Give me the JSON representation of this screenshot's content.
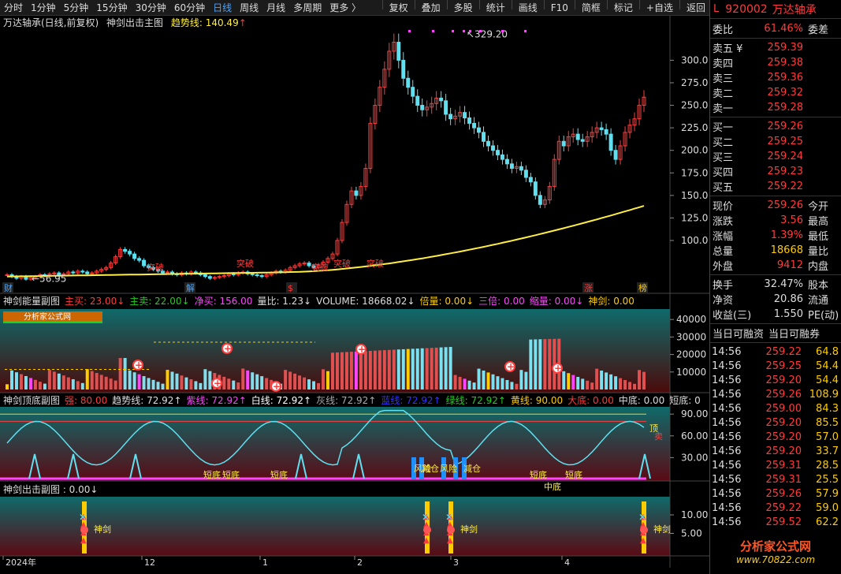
{
  "topbar": {
    "left": [
      "分时",
      "1分钟",
      "5分钟",
      "15分钟",
      "30分钟",
      "60分钟",
      "日线",
      "周线",
      "月线",
      "多周期",
      "更多 〉"
    ],
    "active": "日线",
    "right": [
      "复权",
      "叠加",
      "多股",
      "统计",
      "画线",
      "F10",
      "简框",
      "标记",
      "+自选",
      "返回"
    ]
  },
  "main_title": {
    "stock": "万达轴承(日线,前复权)",
    "indicator": "神剑出击主图",
    "trend_label": "趋势线: 140.49",
    "trend_arrow": "↑"
  },
  "main_axis": {
    "ticks": [
      100,
      125,
      150,
      175,
      200,
      225,
      250,
      275,
      300
    ],
    "max_label": "329.20",
    "min_label": "56.95"
  },
  "main_markers": {
    "left": "财",
    "jie": "解",
    "dollar": "$",
    "zhang": "涨",
    "bang": "榜"
  },
  "tupo_label": "突破",
  "vol_title": [
    {
      "t": "神剑能量副图",
      "c": "#ddd"
    },
    {
      "t": "主买: 23.00↓",
      "c": "#ff3b3b"
    },
    {
      "t": "主卖: 22.00↓",
      "c": "#22cc22"
    },
    {
      "t": "净买: 156.00",
      "c": "#ff44ff"
    },
    {
      "t": "量比: 1.23↓",
      "c": "#ddd"
    },
    {
      "t": "VOLUME: 18668.02↓",
      "c": "#ddd"
    },
    {
      "t": "倍量: 0.00↓",
      "c": "#ffcc00"
    },
    {
      "t": "三倍: 0.00",
      "c": "#ff44ff"
    },
    {
      "t": "缩量: 0.00↓",
      "c": "#ff44ff"
    },
    {
      "t": "神剑: 0.00",
      "c": "#ffcc00"
    }
  ],
  "vol_axis": {
    "ticks": [
      10000,
      20000,
      30000,
      40000
    ]
  },
  "osc_title": [
    {
      "t": "神剑顶底副图",
      "c": "#ddd"
    },
    {
      "t": "强: 80.00",
      "c": "#ff3b3b"
    },
    {
      "t": "趋势线: 72.92↑",
      "c": "#ddd"
    },
    {
      "t": "紫线: 72.92↑",
      "c": "#ff44ff"
    },
    {
      "t": "白线: 72.92↑",
      "c": "#fff"
    },
    {
      "t": "灰线: 72.92↑",
      "c": "#aaa"
    },
    {
      "t": "蓝线: 72.92↑",
      "c": "#3333ff"
    },
    {
      "t": "绿线: 72.92↑",
      "c": "#22cc22"
    },
    {
      "t": "黄线: 90.00",
      "c": "#ffcc00"
    },
    {
      "t": "大底: 0.00",
      "c": "#ff3b3b"
    },
    {
      "t": "中底: 0.00",
      "c": "#ddd"
    },
    {
      "t": "短底: 0",
      "c": "#ddd"
    }
  ],
  "osc_axis": {
    "ticks": [
      30,
      60,
      90
    ]
  },
  "osc_labels": {
    "top": "顶",
    "sell": "卖",
    "fengxian": "风险",
    "jiancang": "减仓",
    "duan": "短底",
    "zhong": "中底"
  },
  "sig_title": "神剑出击副图 : 0.00↓",
  "sig_axis": {
    "ticks": [
      5,
      10
    ]
  },
  "sig_label": "神剑",
  "xaxis": [
    "2024年",
    "12",
    "1",
    "2",
    "3",
    "4"
  ],
  "watermark_top": "分析家公式网",
  "right": {
    "code": "920002",
    "name": "万达轴承",
    "weibi": {
      "l": "委比",
      "v": "61.46%",
      "r": "委差"
    },
    "sells": [
      [
        "卖五 ¥",
        "259.39"
      ],
      [
        "卖四",
        "259.38"
      ],
      [
        "卖三",
        "259.36"
      ],
      [
        "卖二",
        "259.32"
      ],
      [
        "卖一",
        "259.28"
      ]
    ],
    "buys": [
      [
        "买一",
        "259.26"
      ],
      [
        "买二",
        "259.25"
      ],
      [
        "买三",
        "259.24"
      ],
      [
        "买四",
        "259.23"
      ],
      [
        "买五",
        "259.22"
      ]
    ],
    "quote": [
      {
        "l": "现价",
        "v": "259.26",
        "r": "今开",
        "c": "#ff3b3b"
      },
      {
        "l": "涨跌",
        "v": "3.56",
        "r": "最高",
        "c": "#ff3b3b"
      },
      {
        "l": "涨幅",
        "v": "1.39%",
        "r": "最低",
        "c": "#ff3b3b"
      },
      {
        "l": "总量",
        "v": "18668",
        "r": "量比",
        "c": "#ffcc00"
      },
      {
        "l": "外盘",
        "v": "9412",
        "r": "内盘",
        "c": "#ff3b3b"
      }
    ],
    "fund": [
      {
        "l": "换手",
        "v": "32.47%",
        "r": "股本"
      },
      {
        "l": "净资",
        "v": "20.86",
        "r": "流通"
      },
      {
        "l": "收益(三)",
        "v": "1.550",
        "r": "PE(动)"
      }
    ],
    "tabs": [
      "当日可融资",
      "当日可融券"
    ],
    "ticks": [
      [
        "14:56",
        "259.22",
        "64.8"
      ],
      [
        "14:56",
        "259.25",
        "54.4"
      ],
      [
        "14:56",
        "259.20",
        "54.4"
      ],
      [
        "14:56",
        "259.26",
        "108.9"
      ],
      [
        "14:56",
        "259.00",
        "84.3"
      ],
      [
        "14:56",
        "259.20",
        "85.5"
      ],
      [
        "14:56",
        "259.20",
        "57.0"
      ],
      [
        "14:56",
        "259.20",
        "33.7"
      ],
      [
        "14:56",
        "259.31",
        "28.5"
      ],
      [
        "14:56",
        "259.31",
        "25.5"
      ],
      [
        "14:56",
        "259.26",
        "57.9"
      ],
      [
        "14:56",
        "259.22",
        "59.0"
      ],
      [
        "14:56",
        "259.52",
        "62.2"
      ],
      [
        "14:56",
        "259.20",
        "15.0"
      ]
    ],
    "logo": "分析家公式网",
    "logo_url": "www.70822.com"
  },
  "colors": {
    "up": "#ff3b3b",
    "down": "#5ee0f0",
    "trend": "#ffee44",
    "bg": "#000"
  }
}
